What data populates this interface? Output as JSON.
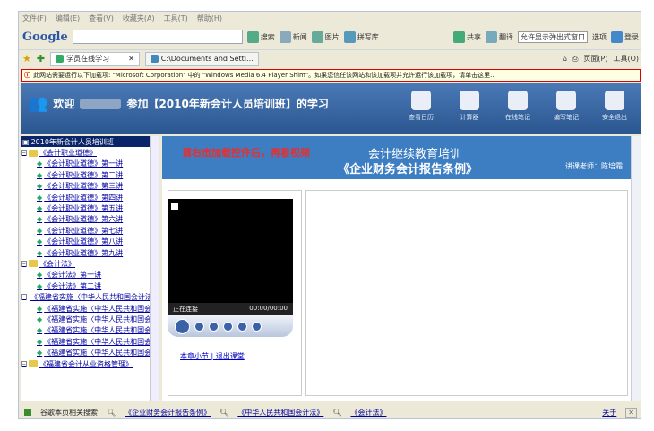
{
  "menubar": {
    "items": [
      "文件(F)",
      "编辑(E)",
      "查看(V)",
      "收藏夹(A)",
      "工具(T)",
      "帮助(H)"
    ]
  },
  "gbar": {
    "logo": "Google",
    "search_label": "搜索",
    "btns": [
      "新闻",
      "图片",
      "拼写库"
    ],
    "right_btns": [
      "共享",
      "翻译",
      "允许显示弹出式窗口",
      "选项",
      "登录"
    ]
  },
  "tabs": {
    "items": [
      "学员在线学习",
      "C:\\Documents and Setti..."
    ],
    "right_tools": [
      "页面(P)",
      "工具(O)"
    ]
  },
  "infobar": {
    "text": "此网站需要运行以下加载项: \"Microsoft Corporation\" 中的 \"Windows Media 6.4 Player Shim\"。如果您信任该网站和该加载项并允许运行该加载项，请单击这里..."
  },
  "header": {
    "welcome": "欢迎",
    "suffix": "参加【2010年新会计人员培训班】的学习",
    "nav": [
      "查看日历",
      "计算器",
      "在线笔记",
      "编写笔记",
      "安全退出"
    ]
  },
  "sidebar": {
    "root": "2010年新会计人员培训班",
    "groups": [
      {
        "label": "《会计职业道德》",
        "items": [
          "《会计职业道德》第一讲",
          "《会计职业道德》第二讲",
          "《会计职业道德》第三讲",
          "《会计职业道德》第四讲",
          "《会计职业道德》第五讲",
          "《会计职业道德》第六讲",
          "《会计职业道德》第七讲",
          "《会计职业道德》第八讲",
          "《会计职业道德》第九讲"
        ]
      },
      {
        "label": "《会计法》",
        "items": [
          "《会计法》第一讲",
          "《会计法》第二讲"
        ]
      },
      {
        "label": "《福建省实施〈中华人民共和国会计法〉办法》",
        "items": [
          "《福建省实施〈中华人民共和国会计法〉办法》",
          "《福建省实施〈中华人民共和国会计法〉办法》",
          "《福建省实施〈中华人民共和国会计法〉办法》",
          "《福建省实施〈中华人民共和国会计法〉办法》",
          "《福建省实施〈中华人民共和国会计法〉办法》"
        ]
      },
      {
        "label": "《福建省会计从业资格管理》",
        "items": []
      }
    ]
  },
  "main": {
    "warning": "请右击加载控件后，再看视频",
    "title1": "会计继续教育培训",
    "title2": "《企业财务会计报告条例》",
    "teacher": "讲课老师：陈培霜",
    "player_status": "正在连接",
    "player_time": "00:00/00:00",
    "links": "本章小节 | 退出课堂"
  },
  "bottom": {
    "label": "谷歌本页相关搜索",
    "keywords": [
      "《企业财务会计报告条例》",
      "《中华人民共和国会计法》",
      "《会计法》"
    ],
    "close": "关于"
  },
  "colors": {
    "header": "#2b5790",
    "course_bar": "#3d7ec3",
    "warning": "#e53030",
    "infobar_border": "#dd0000"
  }
}
